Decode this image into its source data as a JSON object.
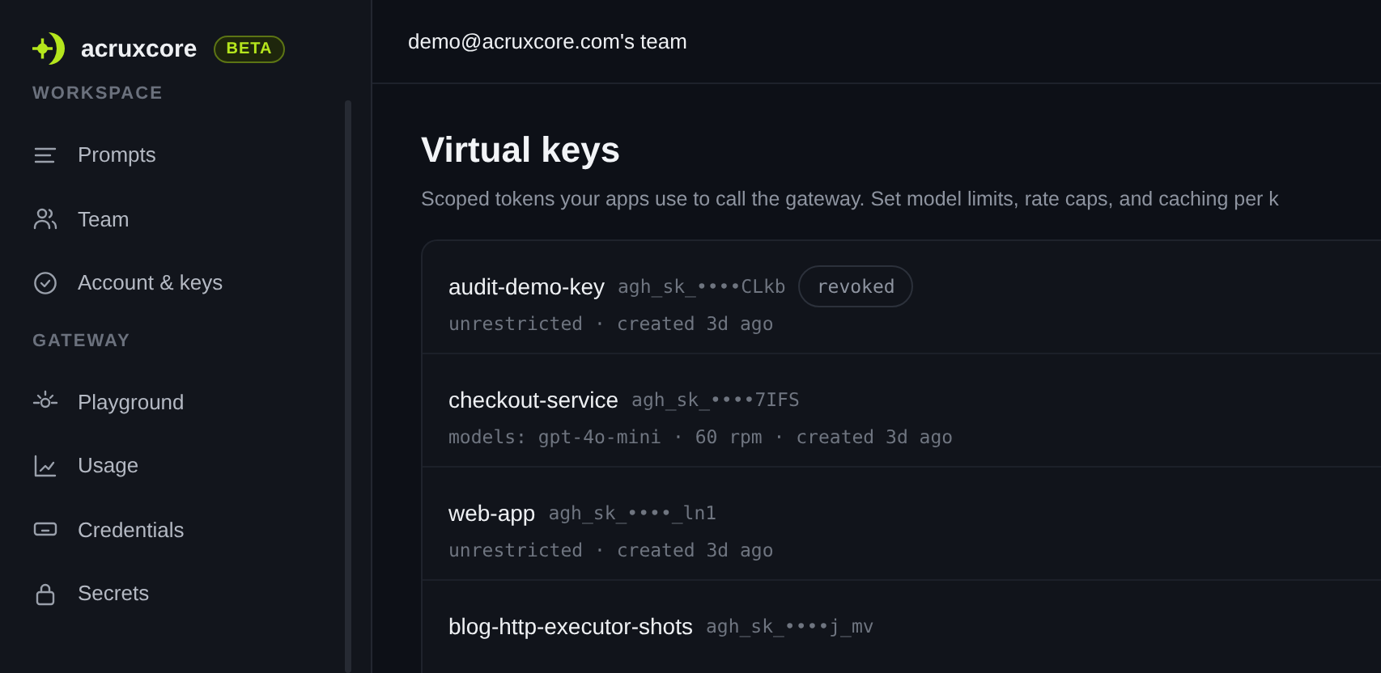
{
  "brand": {
    "name": "acruxcore",
    "badge": "BETA"
  },
  "sidebar": {
    "sections": [
      {
        "title": "WORKSPACE",
        "items": [
          {
            "label": "Prompts"
          },
          {
            "label": "Team"
          },
          {
            "label": "Account & keys"
          }
        ]
      },
      {
        "title": "GATEWAY",
        "items": [
          {
            "label": "Playground"
          },
          {
            "label": "Usage"
          },
          {
            "label": "Credentials"
          },
          {
            "label": "Secrets"
          }
        ]
      }
    ]
  },
  "header": {
    "team": "demo@acruxcore.com's team"
  },
  "page": {
    "title": "Virtual keys",
    "subtitle": "Scoped tokens your apps use to call the gateway. Set model limits, rate caps, and caching per k"
  },
  "keys": [
    {
      "name": "audit-demo-key",
      "key": "agh_sk_••••CLkb",
      "revoked": true,
      "status": "revoked",
      "meta": "unrestricted · created 3d ago"
    },
    {
      "name": "checkout-service",
      "key": "agh_sk_••••7IFS",
      "revoked": false,
      "meta": "models: gpt-4o-mini · 60 rpm · created 3d ago"
    },
    {
      "name": "web-app",
      "key": "agh_sk_••••_ln1",
      "revoked": false,
      "meta": "unrestricted · created 3d ago"
    },
    {
      "name": "blog-http-executor-shots",
      "key": "agh_sk_••••j_mv",
      "revoked": false
    }
  ]
}
